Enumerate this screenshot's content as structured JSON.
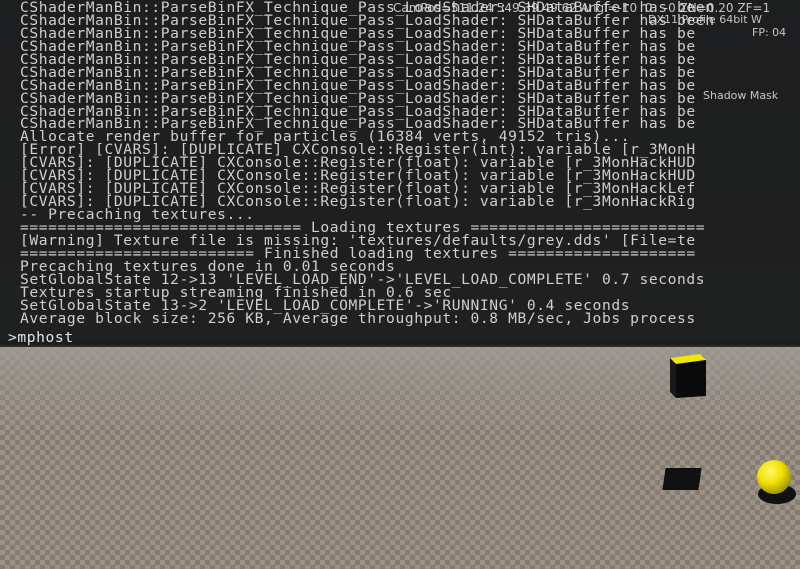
{
  "console": {
    "lines": [
      {
        "text": "CShaderManBin::ParseBinFX_Technique_Pass_LoadShader: SHDataBuffer has been",
        "style": "white"
      },
      {
        "text": "CShaderManBin::ParseBinFX_Technique_Pass_LoadShader: SHDataBuffer has been",
        "style": "white"
      },
      {
        "text": "CShaderManBin::ParseBinFX_Technique_Pass_LoadShader: SHDataBuffer has be",
        "style": "white"
      },
      {
        "text": "CShaderManBin::ParseBinFX_Technique_Pass_LoadShader: SHDataBuffer has be",
        "style": "white"
      },
      {
        "text": "CShaderManBin::ParseBinFX_Technique_Pass_LoadShader: SHDataBuffer has be",
        "style": "white"
      },
      {
        "text": "CShaderManBin::ParseBinFX_Technique_Pass_LoadShader: SHDataBuffer has be",
        "style": "white"
      },
      {
        "text": "CShaderManBin::ParseBinFX_Technique_Pass_LoadShader: SHDataBuffer has be",
        "style": "white"
      },
      {
        "text": "CShaderManBin::ParseBinFX_Technique_Pass_LoadShader: SHDataBuffer has be",
        "style": "white"
      },
      {
        "text": "CShaderManBin::ParseBinFX_Technique_Pass_LoadShader: SHDataBuffer has be",
        "style": "white"
      },
      {
        "text": "CShaderManBin::ParseBinFX_Technique_Pass_LoadShader: SHDataBuffer has be",
        "style": "white"
      },
      {
        "text": "Allocate render buffer for particles (16384 verts, 49152 tris)...",
        "style": "white"
      },
      {
        "text": "[Error] [CVARS]: [DUPLICATE] CXConsole::Register(int): variable [r_3MonH",
        "style": "red"
      },
      {
        "text": "[CVARS]: [DUPLICATE] CXConsole::Register(float): variable [r_3MonHackHUD",
        "style": "white"
      },
      {
        "text": "[CVARS]: [DUPLICATE] CXConsole::Register(float): variable [r_3MonHackHUD",
        "style": "white"
      },
      {
        "text": "[CVARS]: [DUPLICATE] CXConsole::Register(float): variable [r_3MonHackLef",
        "style": "white"
      },
      {
        "text": "[CVARS]: [DUPLICATE] CXConsole::Register(float): variable [r_3MonHackRig",
        "style": "white"
      },
      {
        "text": "-- Precaching textures...",
        "style": "gray"
      },
      {
        "text": "============================== Loading textures =========================",
        "style": "white"
      },
      {
        "text": "[Warning] Texture file is missing: 'textures/defaults/grey.dds' [File=te",
        "style": "yellow"
      },
      {
        "text": "========================= Finished loading textures ====================",
        "style": "white"
      },
      {
        "text": "Precaching textures done in 0.01 seconds",
        "style": "white"
      },
      {
        "text": "SetGlobalState 12->13 'LEVEL_LOAD_END'->'LEVEL_LOAD_COMPLETE' 0.7 seconds",
        "style": "white"
      },
      {
        "text": "Textures startup streaming finished in 0.6 sec",
        "style": "white"
      },
      {
        "text": "SetGlobalState 13->2 'LEVEL_LOAD_COMPLETE'->'RUNNING' 0.4 seconds",
        "style": "white"
      },
      {
        "text": "Average block size: 256 KB, Average throughput: 0.8 MB/sec, Jobs process",
        "style": "white"
      }
    ],
    "prompt": ">mphost"
  },
  "hud": {
    "campos": "CamPos=511.24 549.39 49.62 Angl=-10  0   -0 ZN=0.20 ZF=1",
    "dx": "DX11 Profile 64bit W",
    "fps": "FP: 04",
    "shadow": "Shadow Mask"
  },
  "scene": {
    "cube_color": "#f2e600",
    "sphere_color": "#f0e000",
    "floor_colors": [
      "#9c9288",
      "#857c72"
    ]
  }
}
